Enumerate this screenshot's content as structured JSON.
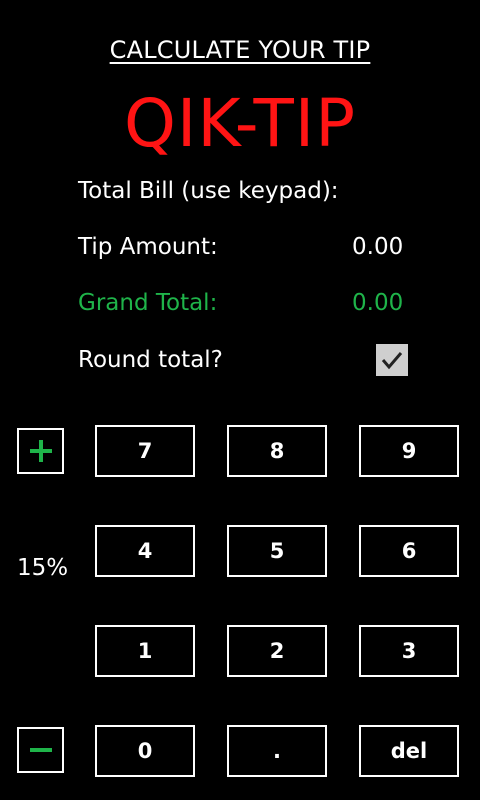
{
  "header": {
    "link_text": "CALCULATE YOUR TIP",
    "app_title": "QIK-TIP"
  },
  "bill": {
    "label": "Total Bill (use keypad):"
  },
  "tip": {
    "label": "Tip Amount:",
    "value": "0.00"
  },
  "grand_total": {
    "label": "Grand Total:",
    "value": "0.00"
  },
  "round": {
    "label": "Round total?",
    "checked": true
  },
  "tip_percent": {
    "value": "15%"
  },
  "keypad": {
    "k7": "7",
    "k8": "8",
    "k9": "9",
    "k4": "4",
    "k5": "5",
    "k6": "6",
    "k1": "1",
    "k2": "2",
    "k3": "3",
    "k0": "0",
    "kdot": ".",
    "kdel": "del"
  },
  "colors": {
    "title_red": "#ff1414",
    "accent_green": "#1fb44a",
    "background": "#000000"
  },
  "icons": {
    "increase": "plus-icon",
    "decrease": "minus-icon",
    "checkbox": "checkmark-icon"
  }
}
